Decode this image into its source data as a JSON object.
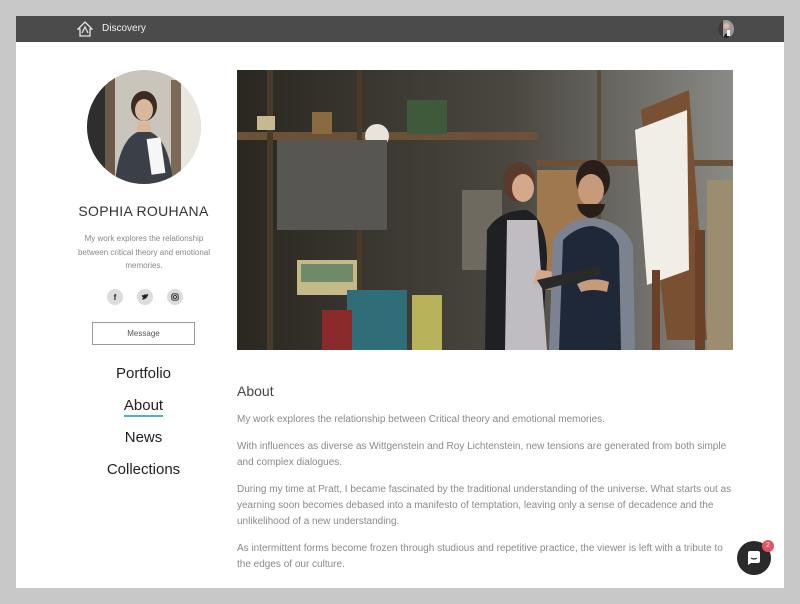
{
  "topbar": {
    "brand": "Discovery",
    "logo_icon": "house-logo-icon",
    "avatar_icon": "user-avatar"
  },
  "profile": {
    "name": "SOPHIA ROUHANA",
    "bio": "My work explores the relationship between critical theory and emotional memories.",
    "socials": [
      {
        "name": "facebook-icon",
        "glyph": "f"
      },
      {
        "name": "twitter-icon",
        "glyph": "t"
      },
      {
        "name": "instagram-icon",
        "glyph": "◎"
      }
    ],
    "message_label": "Message"
  },
  "nav": {
    "items": [
      "Portfolio",
      "About",
      "News",
      "Collections"
    ],
    "active": "About"
  },
  "about": {
    "title": "About",
    "paragraphs": [
      "My work explores the relationship between Critical theory and emotional memories.",
      "With influences as diverse as Wittgenstein and Roy Lichtenstein, new tensions are generated from both simple and complex dialogues.",
      "During my time at Pratt, I became fascinated by the traditional understanding of the universe. What starts out as yearning soon becomes debased into a manifesto of temptation, leaving only a sense of decadence and the unlikelihood of a new understanding.",
      "As intermittent forms become frozen through studious and repetitive practice, the viewer is left with a tribute to the edges of our culture."
    ]
  },
  "chat": {
    "badge_count": "2"
  },
  "colors": {
    "topbar": "#4b4b4b",
    "accent_underline": "#4fb0c6",
    "badge": "#e85161"
  }
}
